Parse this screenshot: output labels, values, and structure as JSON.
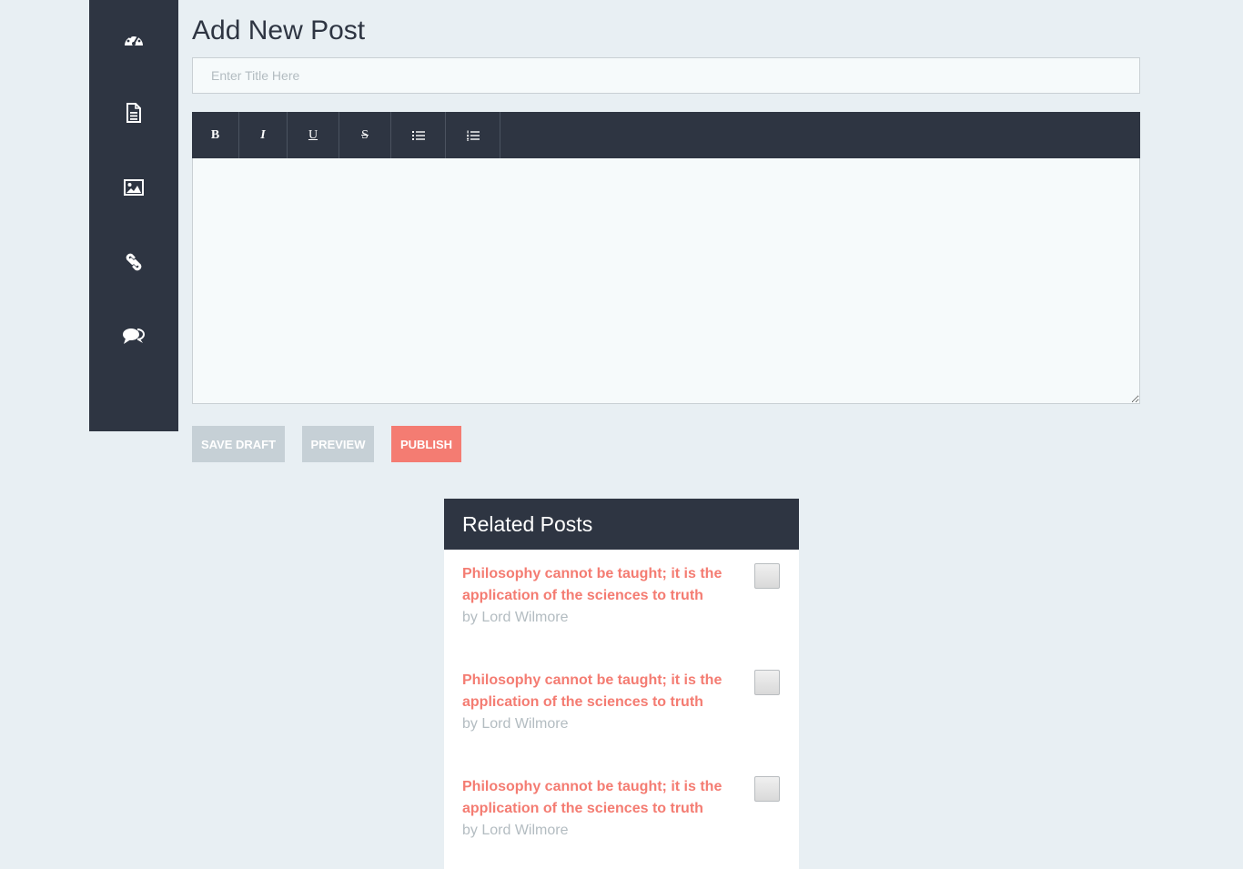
{
  "sidebar": {
    "items": [
      {
        "icon": "dashboard-icon"
      },
      {
        "icon": "document-icon"
      },
      {
        "icon": "image-icon"
      },
      {
        "icon": "link-icon"
      },
      {
        "icon": "comments-icon"
      }
    ]
  },
  "page": {
    "title": "Add New Post",
    "title_placeholder": "Enter Title Here",
    "title_value": ""
  },
  "toolbar": {
    "bold": "B",
    "italic": "I",
    "underline": "U",
    "strike": "S",
    "bullet_list_icon": "bullet-list-icon",
    "numbered_list_icon": "numbered-list-icon"
  },
  "editor": {
    "content": ""
  },
  "actions": {
    "save_draft": "Save Draft",
    "preview": "Preview",
    "publish": "Publish"
  },
  "related": {
    "heading": "Related Posts",
    "posts": [
      {
        "title": "Philosophy cannot be taught; it is the application of the sciences to truth",
        "author": "by Lord Wilmore",
        "checked": false
      },
      {
        "title": "Philosophy cannot be taught; it is the application of the sciences to truth",
        "author": "by Lord Wilmore",
        "checked": false
      },
      {
        "title": "Philosophy cannot be taught; it is the application of the sciences to truth",
        "author": "by Lord Wilmore",
        "checked": false
      }
    ]
  },
  "colors": {
    "background": "#e8eff3",
    "dark": "#2e3542",
    "accent": "#f47c72",
    "muted": "#c6d0d6"
  }
}
